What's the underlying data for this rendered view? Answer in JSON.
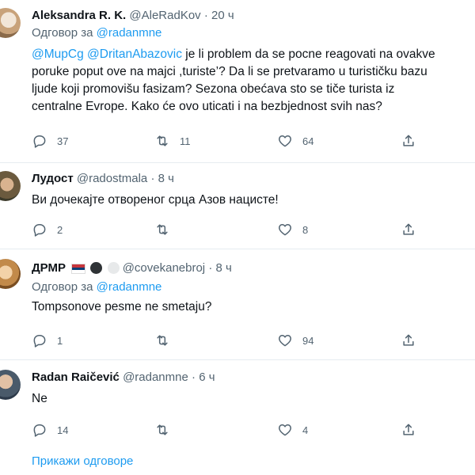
{
  "tweets": [
    {
      "name": "Aleksandra R. K.",
      "handle": "@AleRadKov",
      "time": "20 ч",
      "reply_prefix": "Одговор за",
      "reply_handle": "@radanmne",
      "mention1": "@MupCg",
      "mention2": "@DritanAbazovic",
      "line1_rest": " je li problem da se pocne reagovati na ovakve",
      "line2": "poruke poput ove na majci ,turiste’? Da li se pretvaramo u turističku bazu",
      "line3": "ljude koji promovišu fasizam? Sezona obećava sto se tiče turista iz",
      "line4": "centralne Evrope. Kako će ovo uticati i na bezbjednost svih nas?",
      "replies": "37",
      "retweets": "11",
      "likes": "64"
    },
    {
      "name": "Лудост",
      "handle": "@radostmala",
      "time": "8 ч",
      "text": "Ви дочекајте отвореног срца Азов  нацисте!",
      "replies": "2",
      "retweets": "",
      "likes": "8"
    },
    {
      "name": "ДРМР",
      "handle": "@covekanebroj",
      "time": "8 ч",
      "reply_prefix": "Одговор за",
      "reply_handle": "@radanmne",
      "text": "Tompsonove pesme ne smetaju?",
      "replies": "1",
      "retweets": "",
      "likes": "94"
    },
    {
      "name": "Radan Raičević",
      "handle": "@radanmne",
      "time": "6 ч",
      "text": "Ne",
      "replies": "14",
      "retweets": "",
      "likes": "4"
    }
  ],
  "show_replies": "Прикажи одговоре",
  "dot": "·",
  "colors": {
    "link": "#1d9bf0",
    "muted": "#536471",
    "text": "#0f1419",
    "separator": "#e6ecf0"
  }
}
